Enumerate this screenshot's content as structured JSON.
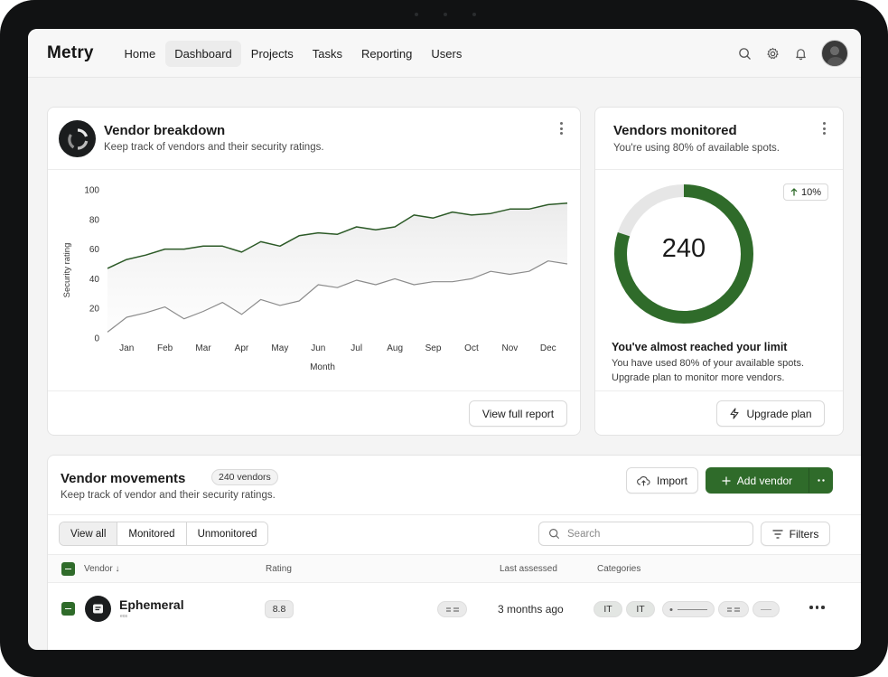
{
  "app": {
    "logo": "Metry"
  },
  "nav": {
    "items": [
      "Home",
      "Dashboard",
      "Projects",
      "Tasks",
      "Reporting",
      "Users"
    ],
    "active": "Dashboard"
  },
  "header_icons": [
    "search-icon",
    "gear-icon",
    "bell-icon",
    "avatar"
  ],
  "breakdown": {
    "title": "Vendor breakdown",
    "subtitle": "Keep track of vendors and their security ratings.",
    "button": "View full report"
  },
  "chart_data": {
    "type": "line",
    "title": "",
    "xlabel": "Month",
    "ylabel": "Security rating",
    "ylim": [
      0,
      100
    ],
    "yticks": [
      0,
      20,
      40,
      60,
      80,
      100
    ],
    "grid": false,
    "legend": "none",
    "x_tick_labels": [
      "Jan",
      "Feb",
      "Mar",
      "Apr",
      "May",
      "Jun",
      "Jul",
      "Aug",
      "Sep",
      "Oct",
      "Nov",
      "Dec"
    ],
    "x": [
      0.5,
      1.0,
      1.5,
      2.0,
      2.5,
      3.0,
      3.5,
      4.0,
      4.5,
      5.0,
      5.5,
      6.0,
      6.5,
      7.0,
      7.5,
      8.0,
      8.5,
      9.0,
      9.5,
      10.0,
      10.5,
      11.0,
      11.5,
      12.0,
      12.5
    ],
    "series": [
      {
        "color": "#2c5a27",
        "values": [
          47,
          53,
          56,
          60,
          60,
          62,
          62,
          58,
          65,
          62,
          69,
          71,
          70,
          75,
          73,
          75,
          83,
          81,
          85,
          83,
          84,
          87,
          87,
          90,
          91
        ]
      },
      {
        "color": "#8c8c8c",
        "values": [
          4,
          14,
          17,
          21,
          13,
          18,
          24,
          16,
          26,
          22,
          25,
          36,
          34,
          39,
          36,
          40,
          36,
          38,
          38,
          40,
          45,
          43,
          45,
          52,
          50
        ]
      }
    ]
  },
  "monitored": {
    "title": "Vendors monitored",
    "subtitle": "You're using 80% of available spots.",
    "value": "240",
    "percent_used": 80,
    "change": "10%",
    "limit_title": "You've almost reached your limit",
    "limit_text_1": "You have used 80% of your available spots.",
    "limit_text_2": "Upgrade plan to monitor more vendors.",
    "button": "Upgrade plan"
  },
  "movements": {
    "title": "Vendor movements",
    "count": "240 vendors",
    "subtitle": "Keep track of vendor and their security ratings.",
    "import_label": "Import",
    "add_label": "Add vendor",
    "filters": [
      "View all",
      "Monitored",
      "Unmonitored"
    ],
    "active_filter": "View all",
    "search_placeholder": "Search",
    "filters_label": "Filters",
    "columns": {
      "vendor": "Vendor",
      "rating": "Rating",
      "last_assessed": "Last assessed",
      "categories": "Categories"
    },
    "rows": [
      {
        "name": "Ephemeral",
        "url": "eos",
        "rating": "8.8",
        "last_assessed": "3 months ago",
        "categories": [
          "IT",
          "IT"
        ]
      }
    ]
  },
  "colors": {
    "accent": "#2f6b2a",
    "donut_track": "#e5e5e5"
  }
}
